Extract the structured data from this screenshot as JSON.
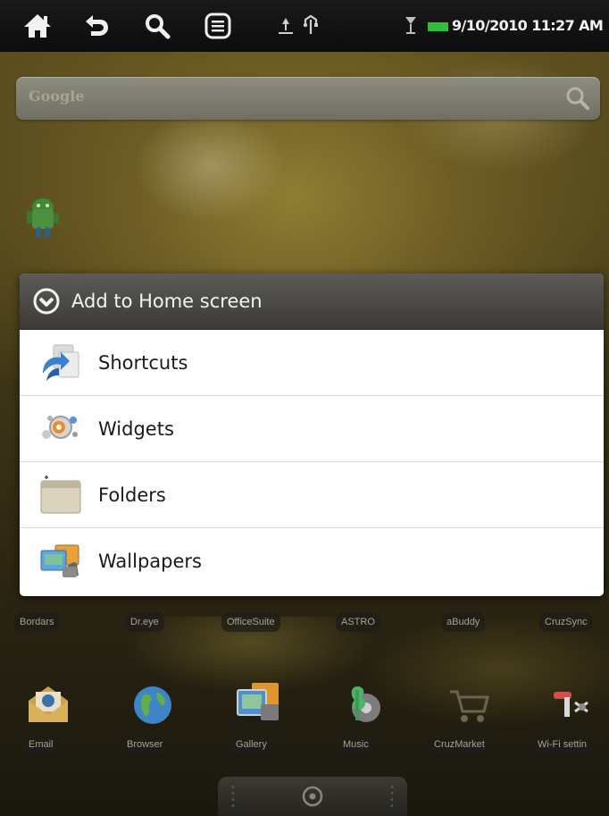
{
  "status_bar": {
    "buttons": [
      {
        "name": "home-icon",
        "label": "Home"
      },
      {
        "name": "back-icon",
        "label": "Back"
      },
      {
        "name": "search-icon",
        "label": "Search"
      },
      {
        "name": "menu-icon",
        "label": "Menu"
      }
    ],
    "status_icons": [
      "usb-debug-icon",
      "usb-connection-icon",
      "signal-icon",
      "battery-icon"
    ],
    "battery_color": "#2fbf3a",
    "datetime": "9/10/2010 11:27 AM"
  },
  "search_widget": {
    "placeholder": "Google",
    "icon": "magnifier-icon"
  },
  "dialog": {
    "title": "Add to Home screen",
    "title_icon": "circle-chevron-down-icon",
    "items": [
      {
        "label": "Shortcuts",
        "icon": "shortcuts-icon"
      },
      {
        "label": "Widgets",
        "icon": "widgets-icon"
      },
      {
        "label": "Folders",
        "icon": "folder-icon"
      },
      {
        "label": "Wallpapers",
        "icon": "wallpapers-icon"
      }
    ]
  },
  "app_row_1": [
    "Bordars",
    "Dr.eye",
    "OfficeSuite",
    "ASTRO",
    "aBuddy",
    "CruzSync"
  ],
  "app_row_2": [
    "Email",
    "Browser",
    "Gallery",
    "Music",
    "CruzMarket",
    "Wi-Fi settin"
  ],
  "launcher": {
    "handle_icon": "launcher-handle-icon"
  }
}
